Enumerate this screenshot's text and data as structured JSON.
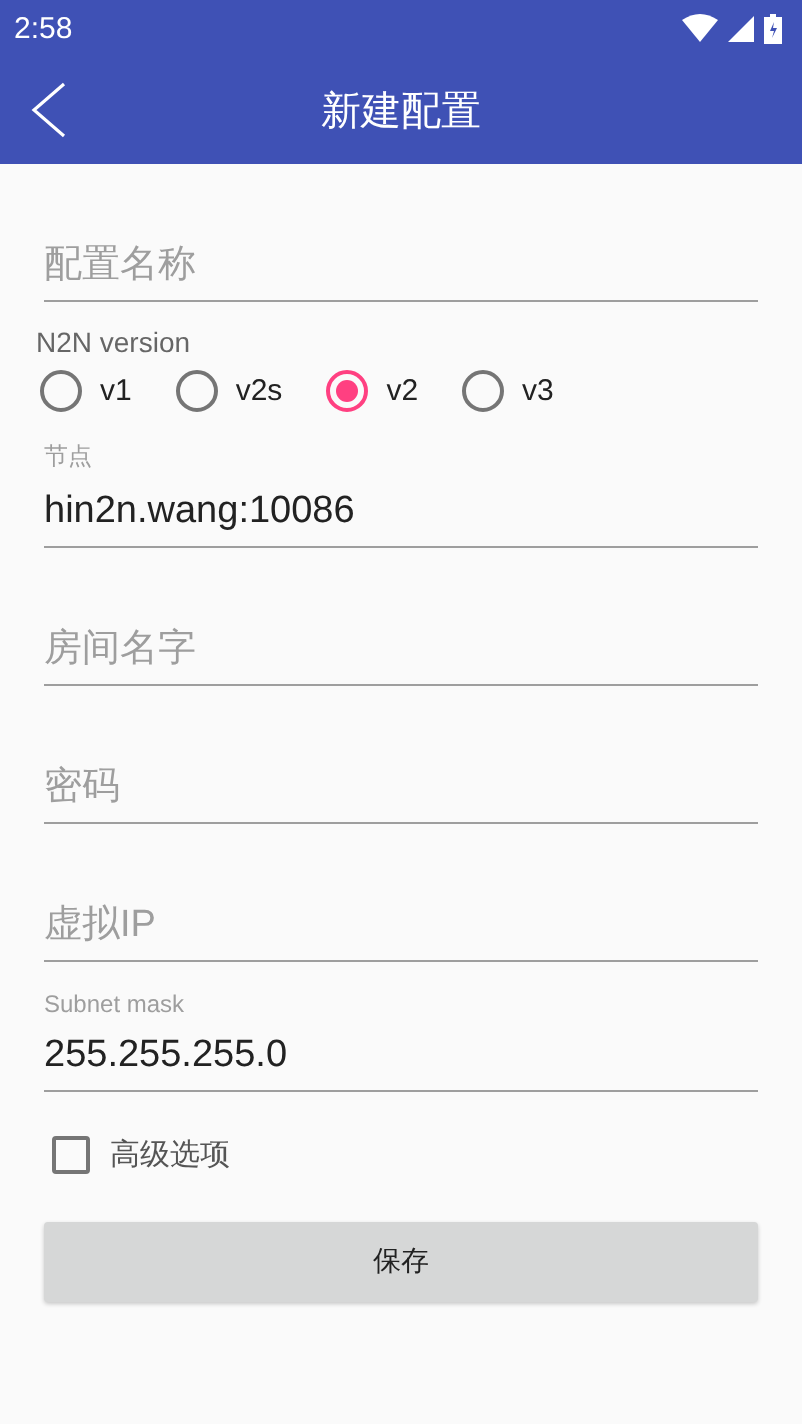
{
  "status_bar": {
    "time": "2:58"
  },
  "app_bar": {
    "title": "新建配置"
  },
  "form": [
    {
      "kind": "field",
      "placeholder": "配置名称"
    },
    {
      "kind": "radio_group",
      "label": "N2N version",
      "options": [
        {
          "label": "v1",
          "selected": false
        },
        {
          "label": "v2s",
          "selected": false
        },
        {
          "label": "v2",
          "selected": true
        },
        {
          "label": "v3",
          "selected": false
        }
      ]
    },
    {
      "kind": "field",
      "label": "节点",
      "value": "hin2n.wang:10086"
    },
    {
      "kind": "field",
      "placeholder": "房间名字"
    },
    {
      "kind": "field",
      "placeholder": "密码"
    },
    {
      "kind": "field",
      "placeholder": "虚拟IP"
    },
    {
      "kind": "field",
      "label": "Subnet mask",
      "value": "255.255.255.0"
    },
    {
      "kind": "checkbox",
      "label": "高级选项",
      "checked": false
    }
  ],
  "button": {
    "label": "保存"
  }
}
